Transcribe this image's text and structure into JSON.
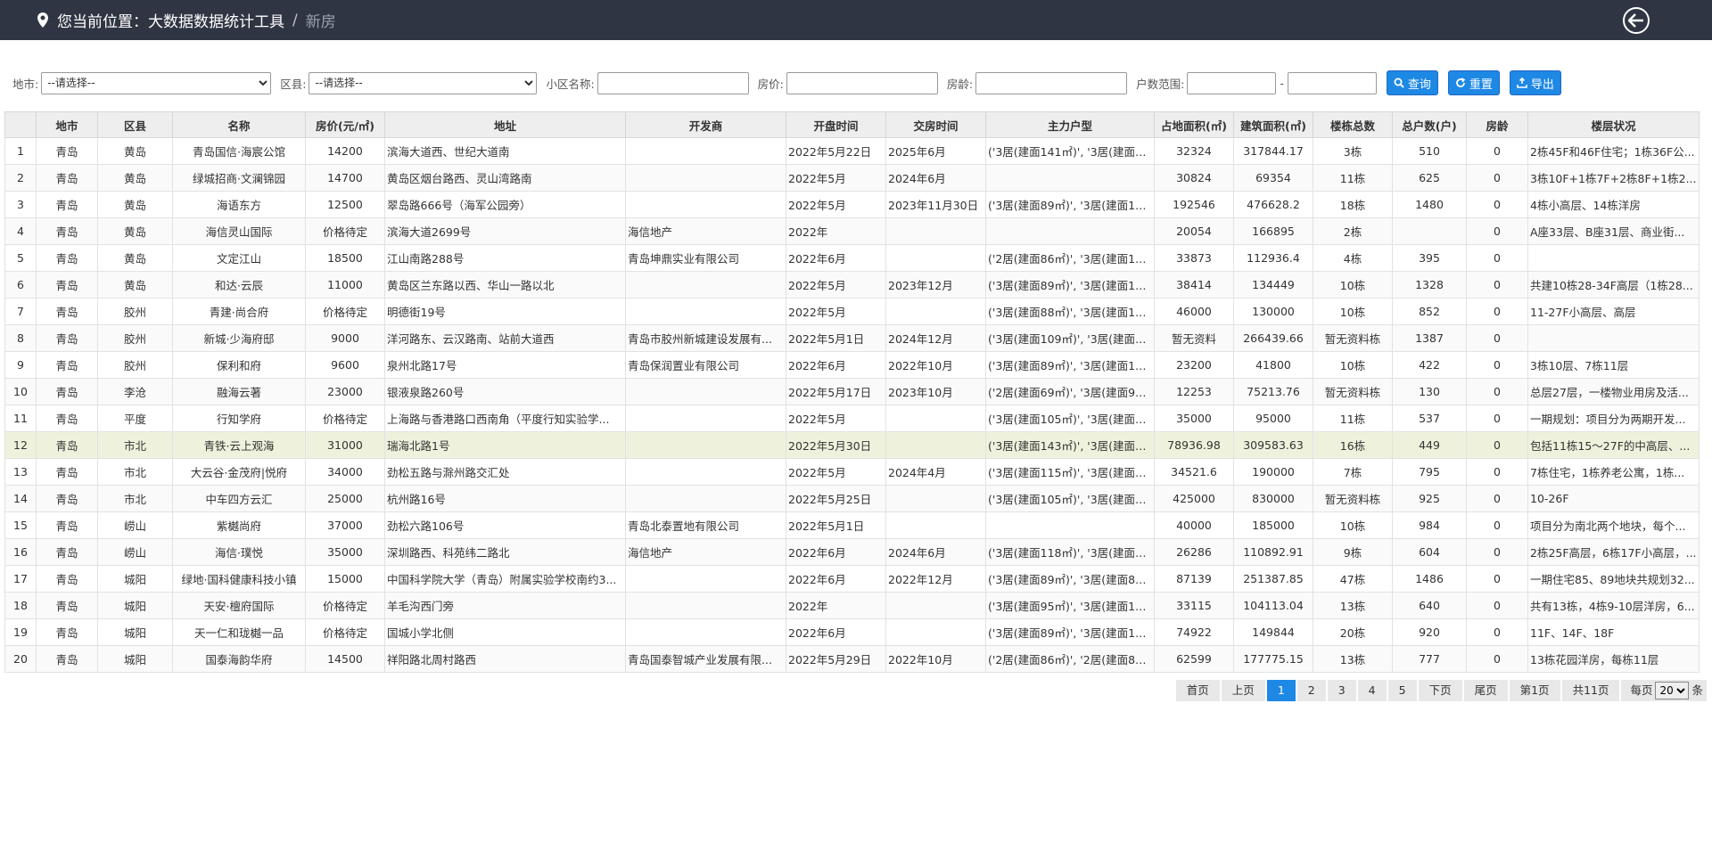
{
  "header": {
    "location_label": "您当前位置：",
    "current": "大数据数据统计工具",
    "separator": "/",
    "last": "新房"
  },
  "filters": {
    "city_label": "地市:",
    "city_value": "--请选择--",
    "district_label": "区县:",
    "district_value": "--请选择--",
    "community_label": "小区名称:",
    "community_value": "",
    "price_label": "房价:",
    "price_value": "",
    "age_label": "房龄:",
    "age_value": "",
    "households_label": "户数范围:",
    "households_from": "",
    "households_dash": "-",
    "households_to": "",
    "query_label": "查询",
    "reset_label": "重置",
    "export_label": "导出"
  },
  "table": {
    "columns": [
      "",
      "地市",
      "区县",
      "名称",
      "房价(元/㎡)",
      "地址",
      "开发商",
      "开盘时间",
      "交房时间",
      "主力户型",
      "占地面积(㎡)",
      "建筑面积(㎡)",
      "楼栋总数",
      "总户数(户)",
      "房龄",
      "楼层状况"
    ],
    "rows": [
      [
        "1",
        "青岛",
        "黄岛",
        "青岛国信·海宸公馆",
        "14200",
        "滨海大道西、世纪大道南",
        "",
        "2022年5月22日",
        "2025年6月",
        "('3居(建面141㎡)', '3居(建面1...",
        "32324",
        "317844.17",
        "3栋",
        "510",
        "0",
        "2栋45F和46F住宅；1栋36F公..."
      ],
      [
        "2",
        "青岛",
        "黄岛",
        "绿城招商·文澜锦园",
        "14700",
        "黄岛区烟台路西、灵山湾路南",
        "",
        "2022年5月",
        "2024年6月",
        "",
        "30824",
        "69354",
        "11栋",
        "625",
        "0",
        "3栋10F+1栋7F+2栋8F+1栋2..."
      ],
      [
        "3",
        "青岛",
        "黄岛",
        "海语东方",
        "12500",
        "翠岛路666号（海军公园旁）",
        "",
        "2022年5月",
        "2023年11月30日",
        "('3居(建面89㎡)', '3居(建面10...",
        "192546",
        "476628.2",
        "18栋",
        "1480",
        "0",
        "4栋小高层、14栋洋房"
      ],
      [
        "4",
        "青岛",
        "黄岛",
        "海信灵山国际",
        "价格待定",
        "滨海大道2699号",
        "海信地产",
        "2022年",
        "",
        "",
        "20054",
        "166895",
        "2栋",
        "",
        "0",
        "A座33层、B座31层、商业街..."
      ],
      [
        "5",
        "青岛",
        "黄岛",
        "文定江山",
        "18500",
        "江山南路288号",
        "青岛坤鼎实业有限公司",
        "2022年6月",
        "",
        "('2居(建面86㎡)', '3居(建面11...",
        "33873",
        "112936.4",
        "4栋",
        "395",
        "0",
        ""
      ],
      [
        "6",
        "青岛",
        "黄岛",
        "和达·云辰",
        "11000",
        "黄岛区兰东路以西、华山一路以北",
        "",
        "2022年5月",
        "2023年12月",
        "('3居(建面89㎡)', '3居(建面10...",
        "38414",
        "134449",
        "10栋",
        "1328",
        "0",
        "共建10栋28-34F高层（1栋28..."
      ],
      [
        "7",
        "青岛",
        "胶州",
        "青建·尚合府",
        "价格待定",
        "明德街19号",
        "",
        "2022年5月",
        "",
        "('3居(建面88㎡)', '3居(建面11...",
        "46000",
        "130000",
        "10栋",
        "852",
        "0",
        "11-27F小高层、高层"
      ],
      [
        "8",
        "青岛",
        "胶州",
        "新城·少海府邸",
        "9000",
        "洋河路东、云汉路南、站前大道西",
        "青岛市胶州新城建设发展有...",
        "2022年5月1日",
        "2024年12月",
        "('3居(建面109㎡)', '3居(建面1...",
        "暂无资料",
        "266439.66",
        "暂无资料栋",
        "1387",
        "0",
        ""
      ],
      [
        "9",
        "青岛",
        "胶州",
        "保利和府",
        "9600",
        "泉州北路17号",
        "青岛保润置业有限公司",
        "2022年6月",
        "2022年10月",
        "('3居(建面89㎡)', '3居(建面10...",
        "23200",
        "41800",
        "10栋",
        "422",
        "0",
        "3栋10层、7栋11层"
      ],
      [
        "10",
        "青岛",
        "李沧",
        "融海云著",
        "23000",
        "银液泉路260号",
        "",
        "2022年5月17日",
        "2023年10月",
        "('2居(建面69㎡)', '3居(建面98...",
        "12253",
        "75213.76",
        "暂无资料栋",
        "130",
        "0",
        "总层27层，一楼物业用房及活..."
      ],
      [
        "11",
        "青岛",
        "平度",
        "行知学府",
        "价格待定",
        "上海路与香港路口西南角（平度行知实验学...",
        "",
        "2022年5月",
        "",
        "('3居(建面105㎡)', '3居(建面1...",
        "35000",
        "95000",
        "11栋",
        "537",
        "0",
        "一期规划：项目分为两期开发..."
      ],
      [
        "12",
        "青岛",
        "市北",
        "青铁·云上观海",
        "31000",
        "瑞海北路1号",
        "",
        "2022年5月30日",
        "",
        "('3居(建面143㎡)', '3居(建面1...",
        "78936.98",
        "309583.63",
        "16栋",
        "449",
        "0",
        "包括11栋15～27F的中高层、..."
      ],
      [
        "13",
        "青岛",
        "市北",
        "大云谷·金茂府|悦府",
        "34000",
        "劲松五路与滁州路交汇处",
        "",
        "2022年5月",
        "2024年4月",
        "('3居(建面115㎡)', '3居(建面1...",
        "34521.6",
        "190000",
        "7栋",
        "795",
        "0",
        "7栋住宅，1栋养老公寓，1栋..."
      ],
      [
        "14",
        "青岛",
        "市北",
        "中车四方云汇",
        "25000",
        "杭州路16号",
        "",
        "2022年5月25日",
        "",
        "('3居(建面105㎡)', '3居(建面1...",
        "425000",
        "830000",
        "暂无资料栋",
        "925",
        "0",
        "10-26F"
      ],
      [
        "15",
        "青岛",
        "崂山",
        "紫樾尚府",
        "37000",
        "劲松六路106号",
        "青岛北泰置地有限公司",
        "2022年5月1日",
        "",
        "",
        "40000",
        "185000",
        "10栋",
        "984",
        "0",
        "项目分为南北两个地块，每个..."
      ],
      [
        "16",
        "青岛",
        "崂山",
        "海信·璞悦",
        "35000",
        "深圳路西、科苑纬二路北",
        "海信地产",
        "2022年6月",
        "2024年6月",
        "('3居(建面118㎡)', '3居(建面1...",
        "26286",
        "110892.91",
        "9栋",
        "604",
        "0",
        "2栋25F高层，6栋17F小高层，..."
      ],
      [
        "17",
        "青岛",
        "城阳",
        "绿地·国科健康科技小镇",
        "15000",
        "中国科学院大学（青岛）附属实验学校南约3...",
        "",
        "2022年6月",
        "2022年12月",
        "('3居(建面89㎡)', '3居(建面89...",
        "87139",
        "251387.85",
        "47栋",
        "1486",
        "0",
        "一期住宅85、89地块共规划32..."
      ],
      [
        "18",
        "青岛",
        "城阳",
        "天安·檀府国际",
        "价格待定",
        "羊毛沟西门旁",
        "",
        "2022年",
        "",
        "('3居(建面95㎡)', '3居(建面10...",
        "33115",
        "104113.04",
        "13栋",
        "640",
        "0",
        "共有13栋，4栋9-10层洋房，6..."
      ],
      [
        "19",
        "青岛",
        "城阳",
        "天一仁和珑樾一品",
        "价格待定",
        "国城小学北侧",
        "",
        "2022年6月",
        "",
        "('3居(建面89㎡)', '3居(建面10...",
        "74922",
        "149844",
        "20栋",
        "920",
        "0",
        "11F、14F、18F"
      ],
      [
        "20",
        "青岛",
        "城阳",
        "国泰海韵华府",
        "14500",
        "祥阳路北周村路西",
        "青岛国泰智城产业发展有限...",
        "2022年5月29日",
        "2022年10月",
        "('2居(建面86㎡)', '2居(建面86...",
        "62599",
        "177775.15",
        "13栋",
        "777",
        "0",
        "13栋花园洋房，每栋11层"
      ]
    ],
    "highlighted_row": 12
  },
  "pager": {
    "first": "首页",
    "prev": "上页",
    "pages": [
      "1",
      "2",
      "3",
      "4",
      "5"
    ],
    "current_page": "1",
    "next": "下页",
    "last": "尾页",
    "page_info": "第1页",
    "total": "共11页",
    "per_page_label": "每页",
    "per_page_value": "20",
    "per_page_suffix": "条"
  }
}
